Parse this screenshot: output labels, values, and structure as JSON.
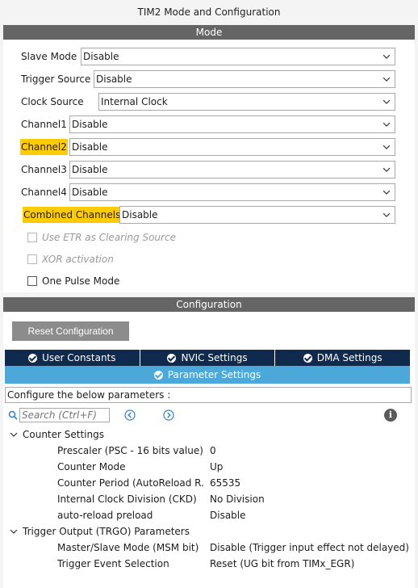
{
  "window": {
    "title": "TIM2 Mode and Configuration"
  },
  "mode": {
    "header": "Mode",
    "fields": [
      {
        "label": "Slave Mode",
        "value": "Disable",
        "highlighted": false
      },
      {
        "label": "Trigger Source",
        "value": "Disable",
        "highlighted": false
      },
      {
        "label": "Clock Source",
        "value": "Internal Clock",
        "highlighted": false
      },
      {
        "label": "Channel1",
        "value": "Disable",
        "highlighted": false
      },
      {
        "label": "Channel2",
        "value": "Disable",
        "highlighted": true
      },
      {
        "label": "Channel3",
        "value": "Disable",
        "highlighted": false
      },
      {
        "label": "Channel4",
        "value": "Disable",
        "highlighted": false
      },
      {
        "label": "Combined Channels",
        "value": "Disable",
        "highlighted": true
      }
    ],
    "checkboxes": [
      {
        "label": "Use ETR as Clearing Source",
        "checked": false,
        "enabled": false
      },
      {
        "label": "XOR activation",
        "checked": false,
        "enabled": false
      },
      {
        "label": "One Pulse Mode",
        "checked": false,
        "enabled": true
      }
    ]
  },
  "configuration": {
    "header": "Configuration",
    "reset_label": "Reset Configuration",
    "tabs": [
      {
        "label": "User Constants",
        "icon": "check-circle-icon"
      },
      {
        "label": "NVIC Settings",
        "icon": "check-circle-icon"
      },
      {
        "label": "DMA Settings",
        "icon": "check-circle-icon"
      }
    ],
    "active_tab": {
      "label": "Parameter Settings",
      "icon": "check-circle-icon"
    },
    "hint": "Configure the below parameters :",
    "search": {
      "placeholder": "Search (Ctrl+F)"
    },
    "groups": [
      {
        "name": "Counter Settings",
        "params": [
          {
            "name": "Prescaler (PSC - 16 bits value)",
            "value": "0"
          },
          {
            "name": "Counter Mode",
            "value": "Up"
          },
          {
            "name": "Counter Period (AutoReload R...",
            "value": "65535"
          },
          {
            "name": "Internal Clock Division (CKD)",
            "value": "No Division"
          },
          {
            "name": "auto-reload preload",
            "value": "Disable"
          }
        ]
      },
      {
        "name": "Trigger Output (TRGO) Parameters",
        "params": [
          {
            "name": "Master/Slave Mode (MSM bit)",
            "value": "Disable (Trigger input effect not delayed)"
          },
          {
            "name": "Trigger Event Selection",
            "value": "Reset (UG bit from TIMx_EGR)"
          }
        ]
      }
    ]
  },
  "colors": {
    "section_bar": "#656565",
    "highlight": "#ffcc00",
    "tab_bar": "#0f2a4d",
    "active_tab": "#4ba8d9",
    "reset_button": "#8c8c8c"
  }
}
